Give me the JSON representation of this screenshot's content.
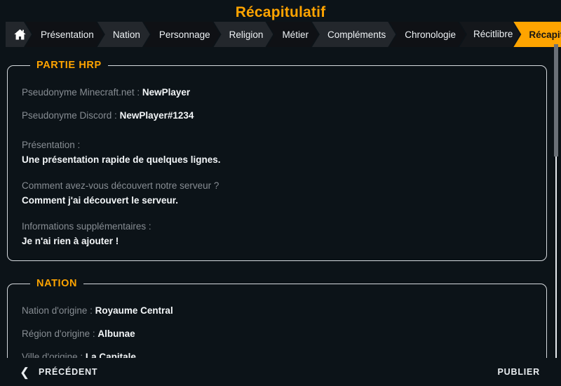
{
  "header": {
    "title": "Récapitulatif"
  },
  "breadcrumb": {
    "home_icon": "home-icon",
    "items": [
      {
        "label": "Présentation",
        "active": false
      },
      {
        "label": "Nation",
        "active": false
      },
      {
        "label": "Personnage",
        "active": false
      },
      {
        "label": "Religion",
        "active": false
      },
      {
        "label": "Métier",
        "active": false
      },
      {
        "label": "Compléments",
        "active": false
      },
      {
        "label": "Chronologie",
        "active": false
      },
      {
        "label": "Récit libre",
        "line1": "Récit",
        "line2": "libre",
        "active": false
      },
      {
        "label": "Récapitulatif",
        "active": true
      }
    ],
    "active_color": "#ffa400"
  },
  "sections": [
    {
      "legend": "PARTIE HRP",
      "rows": [
        {
          "type": "inline",
          "label": "Pseudonyme Minecraft.net :",
          "value": "NewPlayer"
        },
        {
          "type": "inline",
          "label": "Pseudonyme Discord :",
          "value": "NewPlayer#1234"
        },
        {
          "type": "block",
          "label": "Présentation :",
          "value": "Une présentation rapide de quelques lignes."
        },
        {
          "type": "block",
          "label": "Comment avez-vous découvert notre serveur ?",
          "value": "Comment j'ai découvert le serveur."
        },
        {
          "type": "block",
          "label": "Informations supplémentaires :",
          "value": "Je n'ai rien à ajouter !"
        }
      ]
    },
    {
      "legend": "NATION",
      "rows": [
        {
          "type": "inline",
          "label": "Nation d'origine :",
          "value": "Royaume Central"
        },
        {
          "type": "inline",
          "label": "Région d'origine :",
          "value": "Albunae"
        },
        {
          "type": "inline",
          "label": "Ville d'origine :",
          "value": "La Capitale"
        }
      ]
    }
  ],
  "footer": {
    "previous_label": "PRÉCÉDENT",
    "previous_icon": "chevron-left-icon",
    "publish_label": "PUBLIER"
  },
  "colors": {
    "background": "#0c1318",
    "accent": "#ffa400",
    "label_text": "#878d93",
    "value_text": "#f3f6f8",
    "panel_border": "#d6dade"
  }
}
